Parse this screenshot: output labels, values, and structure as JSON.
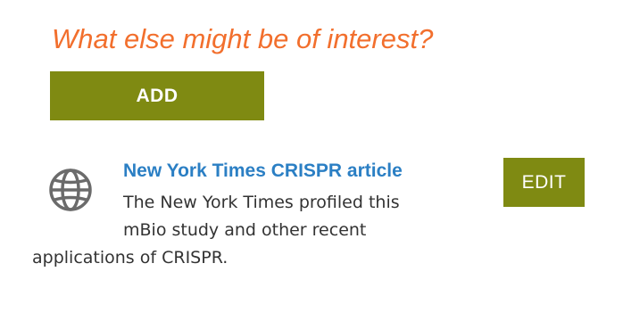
{
  "section": {
    "heading": "What else might be of interest?",
    "add_label": "ADD"
  },
  "resources": [
    {
      "title": "New York Times CRISPR article",
      "description_lines": [
        "The New York Times profiled this",
        "mBio study and other recent",
        "applications of CRISPR."
      ],
      "edit_label": "EDIT",
      "icon": "globe-icon"
    }
  ],
  "colors": {
    "heading": "#f26f2d",
    "button_bg": "#7f8a12",
    "button_text": "#ffffff",
    "link": "#2b7fc4",
    "body_text": "#333333",
    "icon": "#6b6b6b"
  }
}
